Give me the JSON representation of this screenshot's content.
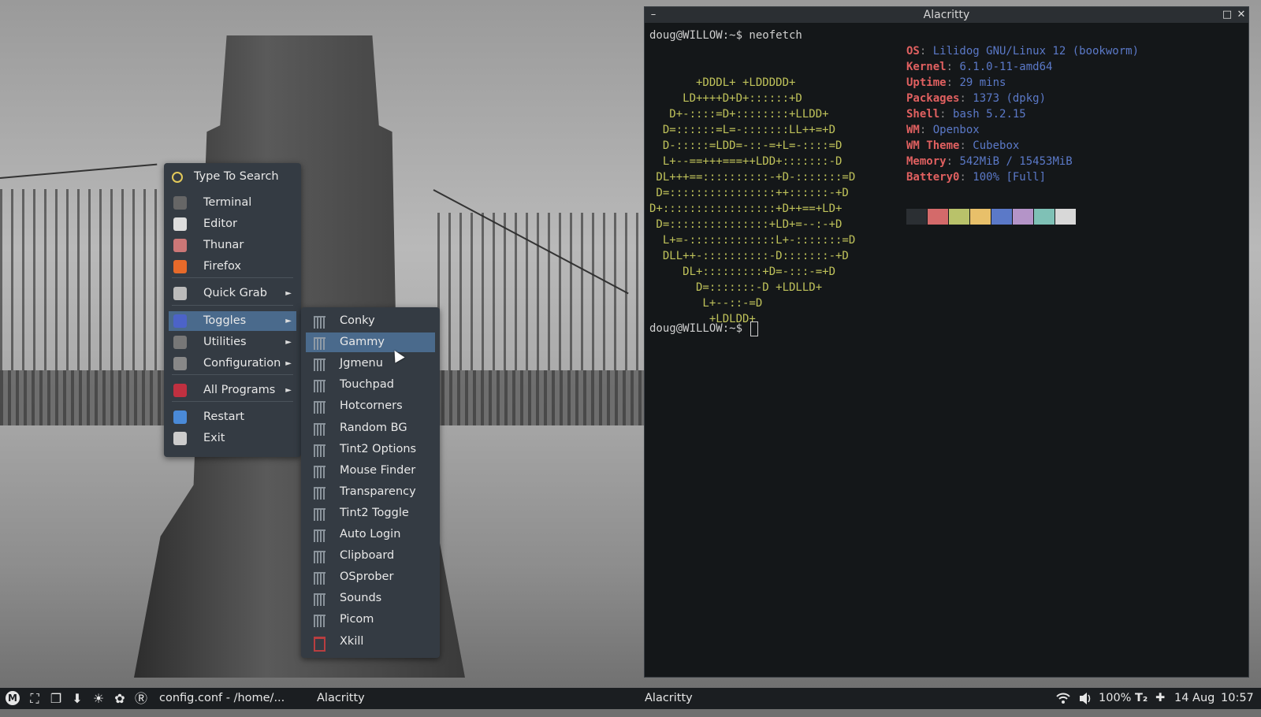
{
  "terminal": {
    "title": "Alacritty",
    "prompt_line1": "doug@WILLOW:~$ neofetch",
    "prompt_line2": "doug@WILLOW:~$ ",
    "logo": [
      "       +DDDL+ +LDDDDD+",
      "     LD++++D+D+::::::+D",
      "   D+-::::=D+::::::::+LLDD+",
      "  D=::::::=L=-:::::::LL++=+D",
      "  D-:::::=LDD=-::-=+L=-::::=D",
      "  L+--==+++===++LDD+:::::::-D",
      " DL+++==::::::::::-+D-:::::::=D",
      " D=::::::::::::::::++::::::-+D",
      "D+:::::::::::::::::+D++==+LD+",
      " D=:::::::::::::::+LD+=--:-+D",
      "  L+=-:::::::::::::L+-:::::::=D",
      "  DLL++-::::::::::-D:::::::-+D",
      "     DL+:::::::::+D=-:::-=+D",
      "       D=:::::::-D +LDLLD+",
      "        L+--::-=D",
      "         +LDLDD+"
    ],
    "info": [
      {
        "key": "OS",
        "value": "Lilidog GNU/Linux 12 (bookworm)"
      },
      {
        "key": "Kernel",
        "value": "6.1.0-11-amd64"
      },
      {
        "key": "Uptime",
        "value": "29 mins"
      },
      {
        "key": "Packages",
        "value": "1373 (dpkg)"
      },
      {
        "key": "Shell",
        "value": "bash 5.2.15"
      },
      {
        "key": "WM",
        "value": "Openbox"
      },
      {
        "key": "WM Theme",
        "value": "Cubebox"
      },
      {
        "key": "Memory",
        "value": "542MiB / 15453MiB"
      },
      {
        "key": "Battery0",
        "value": "100% [Full]"
      }
    ],
    "palette": [
      "#2b2f33",
      "#d46a6a",
      "#b9c26a",
      "#e8c06a",
      "#5b79c8",
      "#b494c8",
      "#7fc1b6",
      "#d8d8d8"
    ]
  },
  "root_menu": {
    "search": "Type To Search",
    "items": [
      {
        "label": "Terminal",
        "icon": "terminal-icon",
        "color": "#666"
      },
      {
        "label": "Editor",
        "icon": "editor-icon",
        "color": "#ddd"
      },
      {
        "label": "Thunar",
        "icon": "thunar-icon",
        "color": "#c77"
      },
      {
        "label": "Firefox",
        "icon": "firefox-icon",
        "color": "#e76a2a"
      },
      {
        "label": "Quick Grab",
        "icon": "screenshot-icon",
        "color": "#bbb",
        "submenu": true
      },
      {
        "label": "Toggles",
        "icon": "toggles-icon",
        "color": "#4c63c8",
        "submenu": true,
        "selected": true
      },
      {
        "label": "Utilities",
        "icon": "utilities-icon",
        "color": "#777",
        "submenu": true
      },
      {
        "label": "Configuration",
        "icon": "configuration-icon",
        "color": "#888",
        "submenu": true
      },
      {
        "label": "All Programs",
        "icon": "all-programs-icon",
        "color": "#c03040",
        "submenu": true
      },
      {
        "label": "Restart",
        "icon": "restart-icon",
        "color": "#4a8ad8"
      },
      {
        "label": "Exit",
        "icon": "exit-icon",
        "color": "#ccc"
      }
    ],
    "arrow": "►"
  },
  "toggles_menu": {
    "items": [
      "Conky",
      "Gammy",
      "Jgmenu",
      "Touchpad",
      "Hotcorners",
      "Random BG",
      "Tint2 Options",
      "Mouse Finder",
      "Transparency",
      "Tint2 Toggle",
      "Auto Login",
      "Clipboard",
      "OSprober",
      "Sounds",
      "Picom",
      "Xkill"
    ],
    "selected": "Gammy"
  },
  "taskbar": {
    "start": "M",
    "icons": [
      "app-grid-icon",
      "window-list-icon",
      "download-icon",
      "brightness-icon",
      "settings-icon",
      "r-icon"
    ],
    "task1": "config.conf - /home/...",
    "task2": "Alacritty",
    "task3": "Alacritty",
    "battery": "100%",
    "keyboard": "T₂",
    "date": "14 Aug",
    "time": "10:57"
  }
}
